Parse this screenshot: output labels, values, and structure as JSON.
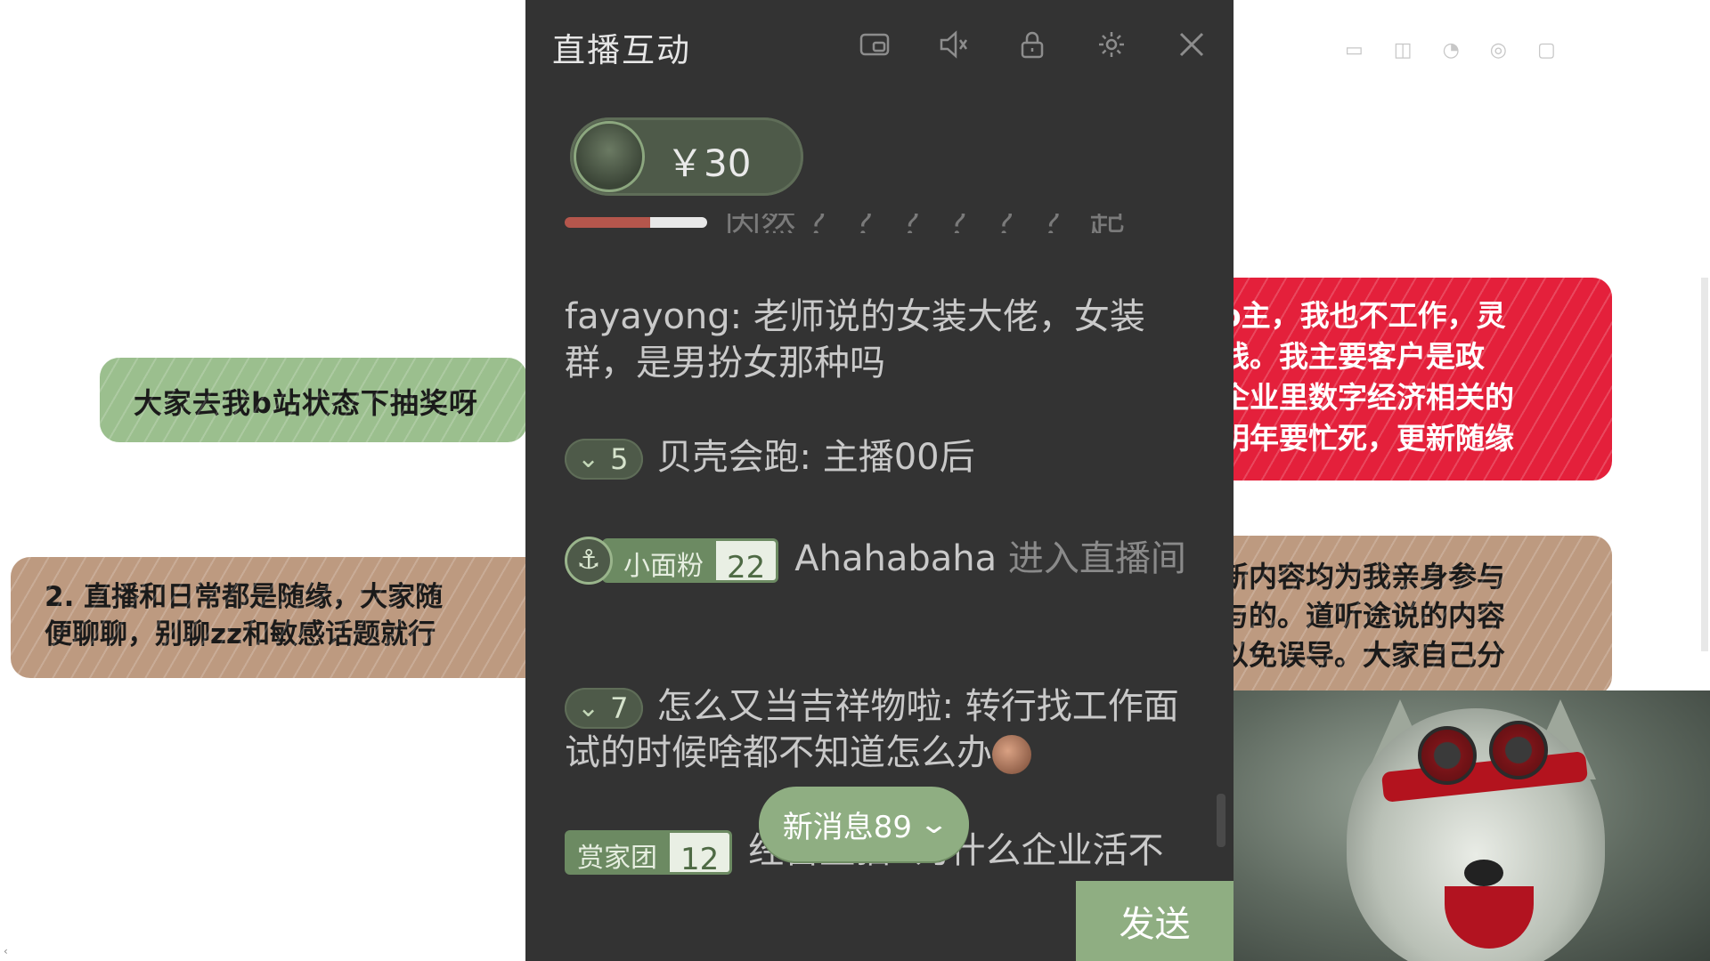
{
  "background_notes": {
    "green": "大家去我b站状态下抽奖呀",
    "brown_left": "2. 直播和日常都是随缘，大家随\n便聊聊，别聊zz和敏感话题就行",
    "red": "p主，我也不工作，灵\n线。我主要客户是政\n企业里数字经济相关的\n明年要忙死，更新随缘",
    "brown_right": "新内容均为我亲身参与\n与的。道听途说的内容\n以免误导。大家自己分"
  },
  "colors": {
    "panel_bg": "#333333",
    "accent_green": "#8fae82",
    "note_red": "#e4203b",
    "note_green": "#9bbf8e",
    "note_brown": "#bd9a80"
  },
  "panel": {
    "title": "直播互动",
    "icons": [
      "pip-icon",
      "mute-icon",
      "lock-icon",
      "gear-icon",
      "close-icon"
    ],
    "gift": {
      "amount": "￥30"
    },
    "clipped_text": "因然 ？ ？ ？ ？ ？ ？ 起 已 无 吃 的",
    "messages": [
      {
        "user": "fayayong",
        "text": "老师说的女装大佬，女装群，是男扮女那种吗"
      },
      {
        "level": "5",
        "user": "贝壳会跑",
        "text": "主播00后"
      },
      {
        "fan_name": "小面粉",
        "fan_level": "22",
        "user": "Ahahabaha",
        "text": "进入直播间"
      },
      {
        "level": "7",
        "user": "怎么又当吉祥物啦",
        "text": "转行找工作面试的时候啥都不知道怎么办"
      },
      {
        "fan_name": "赏家团",
        "fan_level": "12",
        "user": "经营蓝猫",
        "text": "为什么企业活不"
      }
    ],
    "new_messages": "新消息89",
    "send": "发送"
  }
}
